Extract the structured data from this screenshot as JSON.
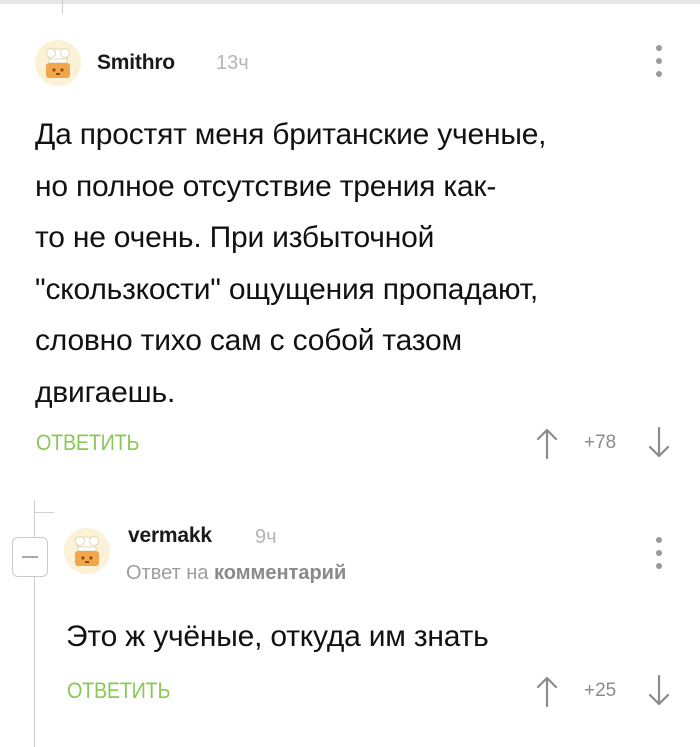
{
  "comments": [
    {
      "author": "Smithro",
      "time": "13ч",
      "text": "Да простят меня британские ученые,\nно полное отсутствие трения как-\nто не очень. При избыточной\n\"скользкости\" ощущения пропадают,\nсловно тихо сам с собой тазом\nдвигаешь.",
      "reply_label": "ОТВЕТИТЬ",
      "score": "+78"
    },
    {
      "author": "vermakk",
      "time": "9ч",
      "reply_to_prefix": "Ответ на",
      "reply_to_link": "комментарий",
      "text": "Это ж учёные, откуда им знать",
      "reply_label": "ОТВЕТИТЬ",
      "score": "+25"
    }
  ],
  "colors": {
    "accent": "#8ac858",
    "muted": "#b5b5b5",
    "line": "#cfcfcf"
  },
  "icons": [
    "chef-avatar-icon",
    "more-vertical-icon",
    "arrow-up-icon",
    "arrow-down-icon",
    "collapse-minus-icon"
  ]
}
